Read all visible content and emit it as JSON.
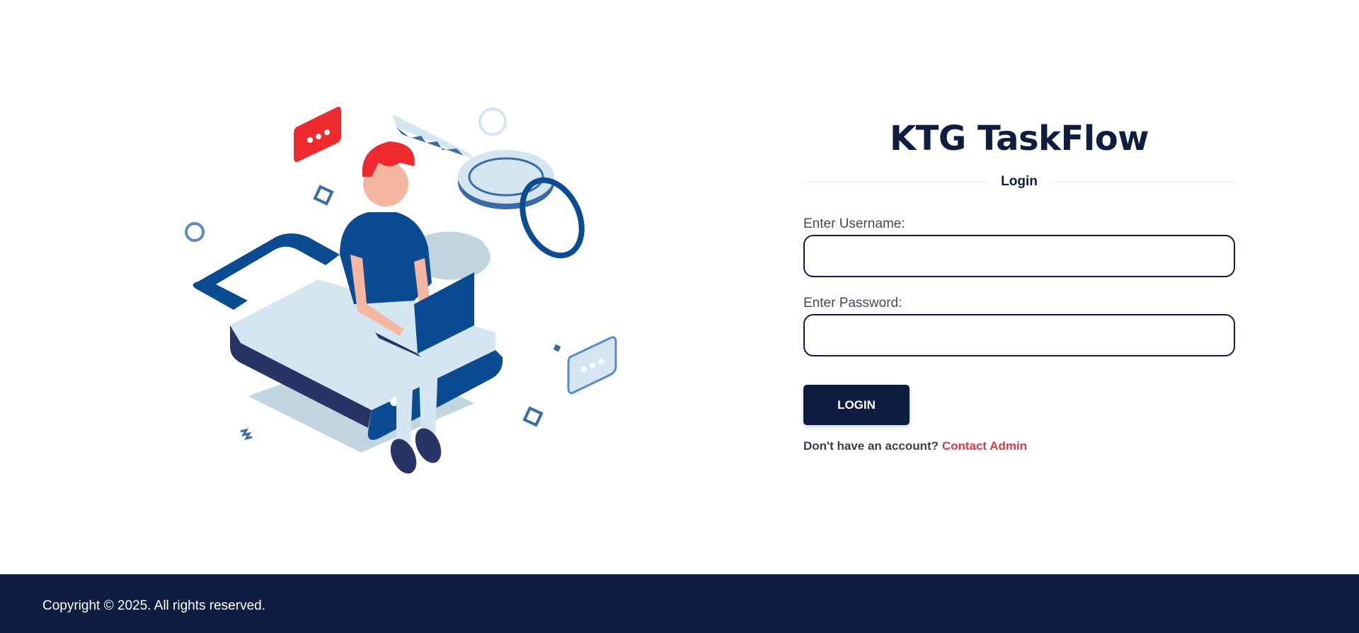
{
  "app": {
    "title": "KTG TaskFlow"
  },
  "form": {
    "section_label": "Login",
    "username_label": "Enter Username:",
    "username_value": "",
    "password_label": "Enter Password:",
    "password_value": "",
    "login_button": "LOGIN",
    "signup_prompt": "Don't have an account?",
    "signup_link": "Contact Admin"
  },
  "footer": {
    "copyright": "Copyright © 2025. All rights reserved."
  },
  "colors": {
    "primary": "#0f1d40",
    "link": "#e0384f",
    "illustration_blue": "#0b4b91",
    "illustration_light": "#d3e6f2",
    "accent_red": "#ee2a2f"
  },
  "icons": [
    "padlock-icon",
    "key-icon",
    "chat-bubble-icon",
    "laptop-icon"
  ]
}
